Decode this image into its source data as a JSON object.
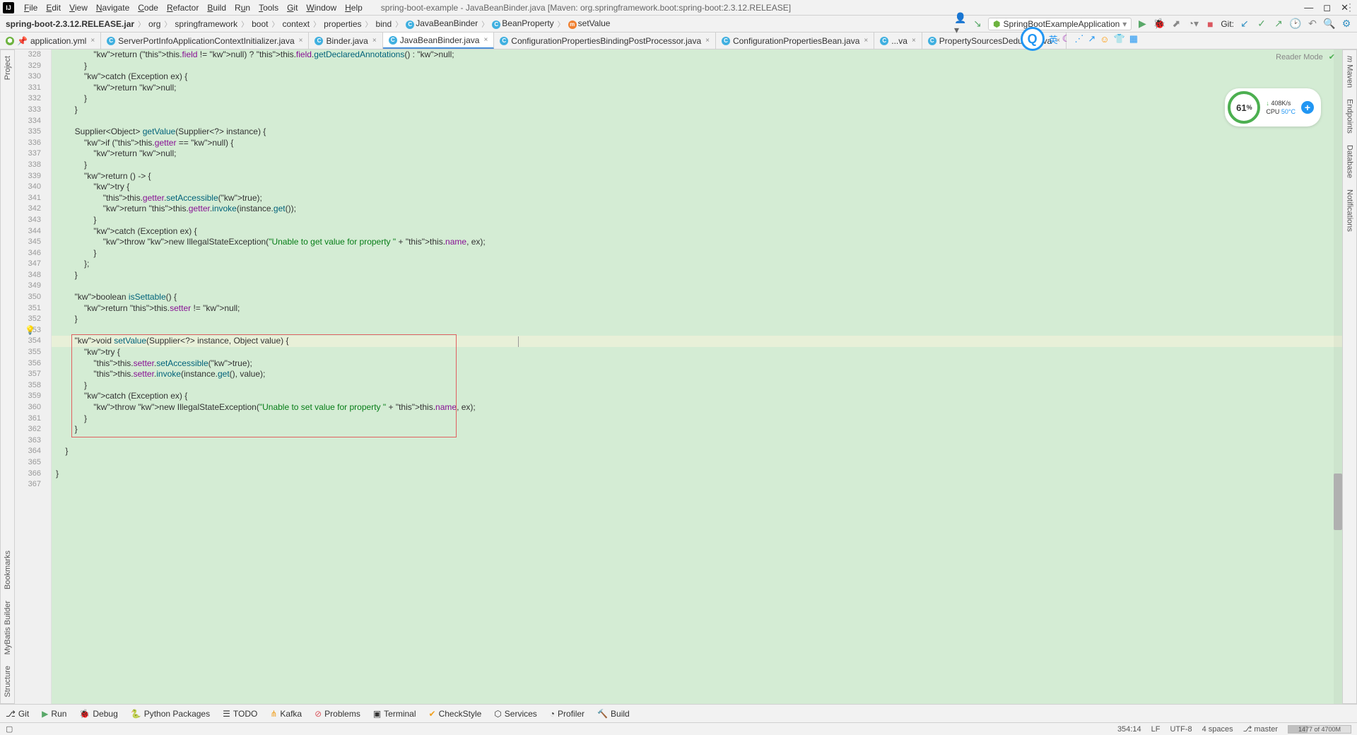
{
  "window": {
    "title": "spring-boot-example - JavaBeanBinder.java [Maven: org.springframework.boot:spring-boot:2.3.12.RELEASE]"
  },
  "menu": {
    "items": [
      "File",
      "Edit",
      "View",
      "Navigate",
      "Code",
      "Refactor",
      "Build",
      "Run",
      "Tools",
      "Git",
      "Window",
      "Help"
    ]
  },
  "breadcrumb": {
    "items": [
      "spring-boot-2.3.12.RELEASE.jar",
      "org",
      "springframework",
      "boot",
      "context",
      "properties",
      "bind",
      "JavaBeanBinder",
      "BeanProperty",
      "setValue"
    ]
  },
  "runConfig": {
    "name": "SpringBootExampleApplication"
  },
  "git": {
    "label": "Git:"
  },
  "tabs": {
    "items": [
      {
        "name": "application.yml",
        "icon": "green",
        "pinned": true
      },
      {
        "name": "ServerPortInfoApplicationContextInitializer.java",
        "icon": "blue"
      },
      {
        "name": "Binder.java",
        "icon": "blue"
      },
      {
        "name": "JavaBeanBinder.java",
        "icon": "blue",
        "active": true
      },
      {
        "name": "ConfigurationPropertiesBindingPostProcessor.java",
        "icon": "blue"
      },
      {
        "name": "ConfigurationPropertiesBean.java",
        "icon": "blue"
      },
      {
        "name": "...va",
        "icon": "blue"
      },
      {
        "name": "PropertySourcesDeducer.java",
        "icon": "blue"
      }
    ]
  },
  "editor": {
    "readerMode": "Reader Mode",
    "startLine": 328,
    "endLine": 367,
    "highlightBox": {
      "startLine": 354,
      "endLine": 362
    },
    "bulbLine": 353,
    "currentLine": 354
  },
  "perf": {
    "percent": "61",
    "percentSuffix": "%",
    "net": "408K/s",
    "cpuLabel": "CPU",
    "cpuValue": "50°C"
  },
  "leftRail": {
    "top": [
      "Project"
    ],
    "bottom": [
      "Bookmarks",
      "MyBatis Builder",
      "Structure"
    ]
  },
  "rightRail": {
    "items": [
      "Maven",
      "Endpoints",
      "Database",
      "Notifications"
    ]
  },
  "bottomToolbar": {
    "items": [
      "Git",
      "Run",
      "Debug",
      "Python Packages",
      "TODO",
      "Kafka",
      "Problems",
      "Terminal",
      "CheckStyle",
      "Services",
      "Profiler",
      "Build"
    ]
  },
  "statusbar": {
    "pos": "354:14",
    "lf": "LF",
    "encoding": "UTF-8",
    "indent": "4 spaces",
    "branch": "master",
    "mem": "1477 of 4700M"
  },
  "code": {
    "l328": "                return (this.field != null) ? this.field.getDeclaredAnnotations() : null;",
    "l329": "            }",
    "l330": "            catch (Exception ex) {",
    "l331": "                return null;",
    "l332": "            }",
    "l333": "        }",
    "l334": "",
    "l335": "        Supplier<Object> getValue(Supplier<?> instance) {",
    "l336": "            if (this.getter == null) {",
    "l337": "                return null;",
    "l338": "            }",
    "l339": "            return () -> {",
    "l340": "                try {",
    "l341": "                    this.getter.setAccessible(true);",
    "l342": "                    return this.getter.invoke(instance.get());",
    "l343": "                }",
    "l344": "                catch (Exception ex) {",
    "l345": "                    throw new IllegalStateException(\"Unable to get value for property \" + this.name, ex);",
    "l346": "                }",
    "l347": "            };",
    "l348": "        }",
    "l349": "",
    "l350": "        boolean isSettable() {",
    "l351": "            return this.setter != null;",
    "l352": "        }",
    "l353": "",
    "l354": "        void setValue(Supplier<?> instance, Object value) {",
    "l355": "            try {",
    "l356": "                this.setter.setAccessible(true);",
    "l357": "                this.setter.invoke(instance.get(), value);",
    "l358": "            }",
    "l359": "            catch (Exception ex) {",
    "l360": "                throw new IllegalStateException(\"Unable to set value for property \" + this.name, ex);",
    "l361": "            }",
    "l362": "        }",
    "l363": "",
    "l364": "    }",
    "l365": "",
    "l366": "}",
    "l367": ""
  }
}
